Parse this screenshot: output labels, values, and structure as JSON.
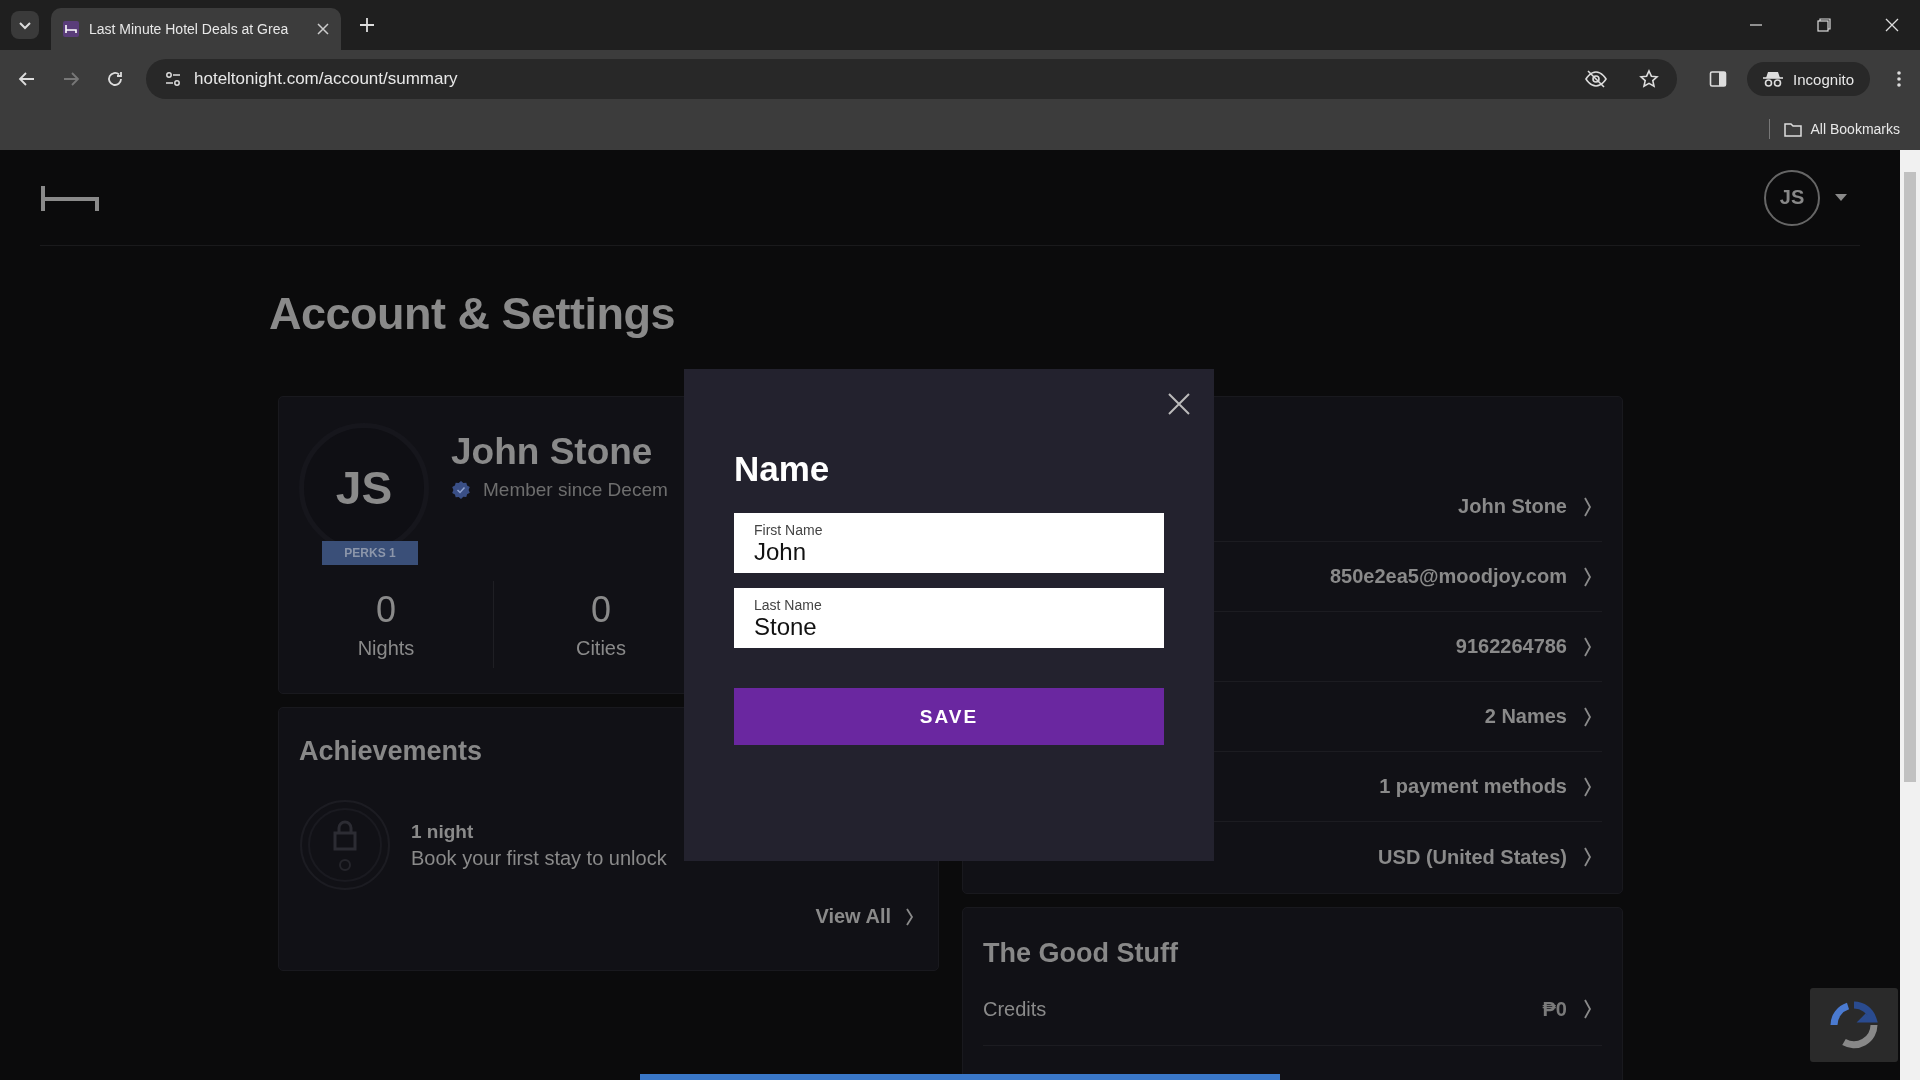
{
  "browser": {
    "tab_title": "Last Minute Hotel Deals at Grea",
    "url": "hoteltonight.com/account/summary",
    "profile_label": "Incognito",
    "bookmarks_label": "All Bookmarks"
  },
  "header": {
    "avatar_initials": "JS"
  },
  "page_title": "Account & Settings",
  "profile": {
    "initials": "JS",
    "badge": "PERKS 1",
    "name": "John Stone",
    "member_since": "Member since Decem",
    "stats": [
      {
        "value": "0",
        "label": "Nights"
      },
      {
        "value": "0",
        "label": "Cities"
      }
    ]
  },
  "achievements": {
    "title": "Achievements",
    "items": [
      {
        "title": "1 night",
        "description": "Book your first stay to unlock"
      }
    ],
    "link": "View All"
  },
  "account_rows": [
    {
      "value": "John Stone"
    },
    {
      "value": "850e2ea5@moodjoy.com"
    },
    {
      "value": "9162264786"
    },
    {
      "value": "2 Names"
    },
    {
      "value": "1 payment methods"
    },
    {
      "value": "USD (United States)"
    }
  ],
  "good_stuff": {
    "title": "The Good Stuff",
    "rows": [
      {
        "label": "Credits",
        "value": "₱0"
      }
    ]
  },
  "modal": {
    "title": "Name",
    "fields": [
      {
        "label": "First Name",
        "value": "John"
      },
      {
        "label": "Last Name",
        "value": "Stone"
      }
    ],
    "button": "SAVE"
  }
}
